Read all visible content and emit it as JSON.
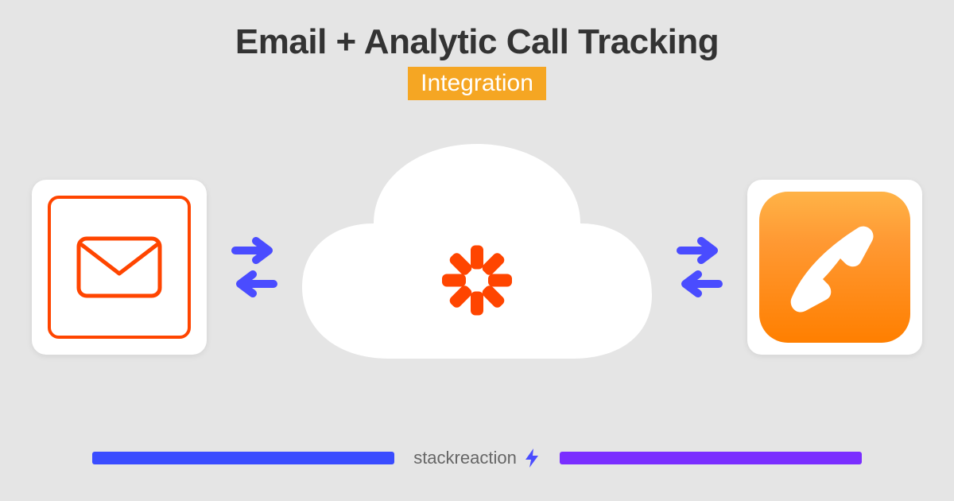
{
  "header": {
    "title": "Email + Analytic Call Tracking",
    "badge": "Integration"
  },
  "services": {
    "left": {
      "name": "Email"
    },
    "right": {
      "name": "Analytic Call Tracking"
    },
    "connector": {
      "name": "Zapier"
    }
  },
  "brand": {
    "name": "stackreaction"
  },
  "colors": {
    "orange": "#ff4500",
    "badge": "#f5a623",
    "blue": "#3a4cff",
    "purple": "#7a2eff",
    "arrow": "#4a4cff"
  }
}
